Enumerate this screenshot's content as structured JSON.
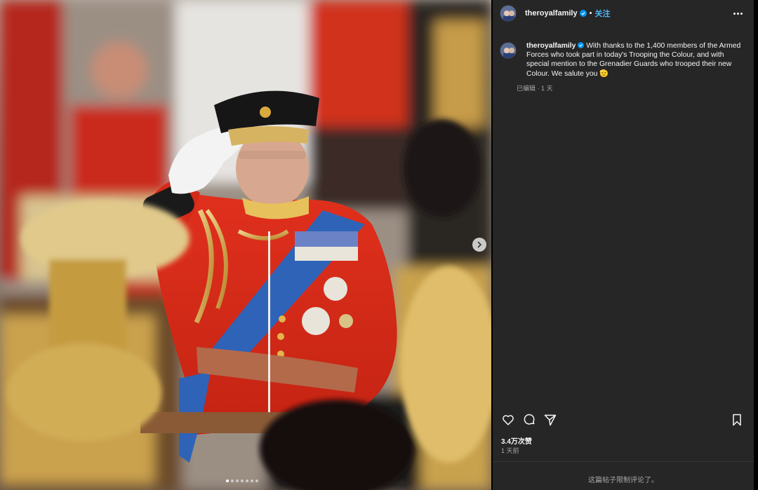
{
  "post": {
    "username": "theroyalfamily",
    "separator": "•",
    "follow_label": "关注",
    "caption": "With thanks to the 1,400 members of the Armed Forces who took part in today's Trooping the Colour, and with special mention to the Grenadier Guards who trooped their new Colour. We salute you 🫡",
    "edited_label": "已编辑 · 1 天",
    "likes": "3.4万次赞",
    "time_ago": "1 天前",
    "comments_disabled": "这篇帖子限制评论了。"
  },
  "carousel": {
    "slide_count": 7,
    "active_index": 0
  },
  "icons": {
    "verified": "verified-badge-icon",
    "more": "more-options-icon",
    "like": "heart-icon",
    "comment": "comment-bubble-icon",
    "share": "paper-plane-icon",
    "save": "bookmark-icon",
    "next": "chevron-right-icon"
  },
  "colors": {
    "panel_bg": "#262626",
    "follow_blue": "#4cb5f9",
    "verified_blue": "#0095f6",
    "muted_text": "#a8a8a8"
  }
}
